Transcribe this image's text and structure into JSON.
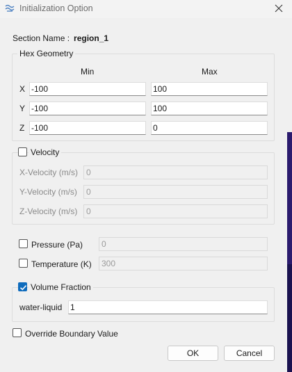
{
  "window": {
    "title": "Initialization Option"
  },
  "section": {
    "label": "Section Name :",
    "value": "region_1"
  },
  "hex": {
    "title": "Hex Geometry",
    "min_header": "Min",
    "max_header": "Max",
    "rows": [
      {
        "axis": "X",
        "min": "-100",
        "max": "100"
      },
      {
        "axis": "Y",
        "min": "-100",
        "max": "100"
      },
      {
        "axis": "Z",
        "min": "-100",
        "max": "0"
      }
    ]
  },
  "velocity": {
    "label": "Velocity",
    "checked": false,
    "rows": [
      {
        "label": "X-Velocity (m/s)",
        "value": "0"
      },
      {
        "label": "Y-Velocity (m/s)",
        "value": "0"
      },
      {
        "label": "Z-Velocity (m/s)",
        "value": "0"
      }
    ]
  },
  "pressure": {
    "label": "Pressure (Pa)",
    "checked": false,
    "value": "0"
  },
  "temperature": {
    "label": "Temperature (K)",
    "checked": false,
    "value": "300"
  },
  "volume_fraction": {
    "label": "Volume Fraction",
    "checked": true,
    "phase_label": "water-liquid",
    "value": "1"
  },
  "override": {
    "label": "Override Boundary Value",
    "checked": false
  },
  "buttons": {
    "ok": "OK",
    "cancel": "Cancel"
  },
  "colors": {
    "accent": "#0f6cbd",
    "background": "#f0f0f0"
  }
}
